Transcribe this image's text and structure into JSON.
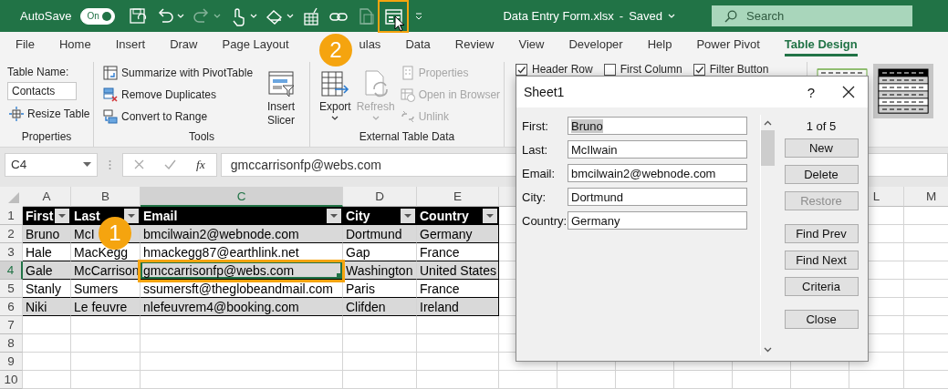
{
  "title_bar": {
    "autosave_label": "AutoSave",
    "autosave_on": true,
    "autosave_state": "On",
    "quick_access": [
      {
        "kind": "save",
        "dropdown": false,
        "disabled": false,
        "highlighted": false
      },
      {
        "kind": "undo",
        "dropdown": true,
        "disabled": false,
        "highlighted": false
      },
      {
        "kind": "redo",
        "dropdown": true,
        "disabled": true,
        "highlighted": false
      },
      {
        "kind": "touch",
        "dropdown": true,
        "disabled": false,
        "highlighted": false
      },
      {
        "kind": "shape",
        "dropdown": true,
        "disabled": false,
        "highlighted": false
      },
      {
        "kind": "grid",
        "dropdown": false,
        "disabled": false,
        "highlighted": false
      },
      {
        "kind": "link",
        "dropdown": false,
        "disabled": false,
        "highlighted": false
      },
      {
        "kind": "doc",
        "dropdown": false,
        "disabled": true,
        "highlighted": false
      },
      {
        "kind": "form",
        "dropdown": false,
        "disabled": false,
        "highlighted": true
      }
    ],
    "document_title": "Data Entry Form.xlsx",
    "title_separator": "-",
    "save_status": "Saved",
    "search_placeholder": "Search"
  },
  "tabs": [
    {
      "label": "File",
      "selected": false
    },
    {
      "label": "Home",
      "selected": false
    },
    {
      "label": "Insert",
      "selected": false
    },
    {
      "label": "Draw",
      "selected": false
    },
    {
      "label": "Page Layout",
      "selected": false
    },
    {
      "label": "ulas",
      "selected": false
    },
    {
      "label": "Data",
      "selected": false
    },
    {
      "label": "Review",
      "selected": false
    },
    {
      "label": "View",
      "selected": false
    },
    {
      "label": "Developer",
      "selected": false
    },
    {
      "label": "Help",
      "selected": false
    },
    {
      "label": "Power Pivot",
      "selected": false
    },
    {
      "label": "Table Design",
      "selected": true
    }
  ],
  "ribbon": {
    "groups": [
      {
        "kind": "properties",
        "label": "Properties",
        "items": [
          {
            "kind": "caption",
            "text": "Table Name:"
          },
          {
            "kind": "field",
            "value": "Contacts"
          },
          {
            "kind": "small",
            "text": "Resize Table",
            "disabled": false
          }
        ]
      },
      {
        "kind": "tools",
        "label": "Tools",
        "items": [
          {
            "kind": "small",
            "text": "Summarize with PivotTable",
            "disabled": false
          },
          {
            "kind": "small",
            "text": "Remove Duplicates",
            "disabled": false
          },
          {
            "kind": "small",
            "text": "Convert to Range",
            "disabled": false
          },
          {
            "kind": "large",
            "text": "Insert Slicer",
            "dropdown": false,
            "disabled": false
          }
        ]
      },
      {
        "kind": "external",
        "label": "External Table Data",
        "items": [
          {
            "kind": "large",
            "text": "Export",
            "dropdown": true,
            "disabled": false
          },
          {
            "kind": "large",
            "text": "Refresh",
            "dropdown": true,
            "disabled": true
          },
          {
            "kind": "small",
            "text": "Properties",
            "disabled": true
          },
          {
            "kind": "small",
            "text": "Open in Browser",
            "disabled": true
          },
          {
            "kind": "small",
            "text": "Unlink",
            "disabled": true
          }
        ]
      },
      {
        "kind": "options",
        "items": [
          {
            "kind": "checkbox",
            "text": "Header Row",
            "checked": true
          },
          {
            "kind": "checkbox",
            "text": "First Column",
            "checked": false
          },
          {
            "kind": "checkbox",
            "text": "Filter Button",
            "checked": true
          }
        ]
      },
      {
        "kind": "styles",
        "items": [
          {
            "kind": "style",
            "selected": false
          },
          {
            "kind": "style",
            "selected": true
          }
        ]
      }
    ]
  },
  "formula_bar": {
    "name_box": "C4",
    "function_button": "fx",
    "formula": "gmccarrisonfp@webs.com"
  },
  "sheet": {
    "highlight_active_cell": true,
    "columns": [
      {
        "letter": "A",
        "selected": false
      },
      {
        "letter": "B",
        "selected": false
      },
      {
        "letter": "C",
        "selected": true
      },
      {
        "letter": "D",
        "selected": false
      },
      {
        "letter": "E",
        "selected": false
      },
      {
        "letter": "L",
        "selected": false
      },
      {
        "letter": "M",
        "selected": false
      }
    ],
    "rows": [
      {
        "number": "1",
        "kind": "header",
        "selected": false,
        "cells": [
          "First",
          "Last",
          "Email",
          "City",
          "Country"
        ]
      },
      {
        "number": "2",
        "kind": "record",
        "selected": false,
        "cells": [
          "Bruno",
          "McI",
          "bmcilwain2@webnode.com",
          "Dortmund",
          "Germany"
        ]
      },
      {
        "number": "3",
        "kind": "record",
        "selected": false,
        "cells": [
          "Hale",
          "MacKegg",
          "hmackegg87@earthlink.net",
          "Gap",
          "France"
        ]
      },
      {
        "number": "4",
        "kind": "record",
        "selected": true,
        "cells": [
          "Gale",
          "McCarrison",
          "gmccarrisonfp@webs.com",
          "Washington",
          "United States"
        ]
      },
      {
        "number": "5",
        "kind": "record",
        "selected": false,
        "cells": [
          "Stanly",
          "Sumers",
          "ssumersft@theglobeandmail.com",
          "Paris",
          "France"
        ]
      },
      {
        "number": "6",
        "kind": "record",
        "selected": false,
        "cells": [
          "Niki",
          "Le feuvre",
          "nlefeuvrem4@booking.com",
          "Clifden",
          "Ireland"
        ]
      },
      {
        "number": "7",
        "kind": "empty",
        "selected": false
      },
      {
        "number": "8",
        "kind": "empty",
        "selected": false
      },
      {
        "number": "9",
        "kind": "empty",
        "selected": false
      },
      {
        "number": "10",
        "kind": "empty",
        "selected": false
      }
    ]
  },
  "dialog": {
    "title": "Sheet1",
    "help": "?",
    "record": "1 of 5",
    "fields": [
      {
        "label": "First:",
        "value": "Bruno",
        "highlighted": true
      },
      {
        "label": "Last:",
        "value": "McIlwain",
        "highlighted": false
      },
      {
        "label": "Email:",
        "value": "bmcilwain2@webnode.com",
        "highlighted": false
      },
      {
        "label": "City:",
        "value": "Dortmund",
        "highlighted": false
      },
      {
        "label": "Country:",
        "value": "Germany",
        "highlighted": false
      }
    ],
    "buttons": [
      {
        "label": "New",
        "disabled": false
      },
      {
        "label": "Delete",
        "disabled": false
      },
      {
        "label": "Restore",
        "disabled": true
      },
      {
        "label": "Find Prev",
        "disabled": false
      },
      {
        "label": "Find Next",
        "disabled": false
      },
      {
        "label": "Criteria",
        "disabled": false
      },
      {
        "label": "Close",
        "disabled": false
      }
    ]
  },
  "callouts": [
    {
      "number": "1"
    },
    {
      "number": "2"
    }
  ]
}
